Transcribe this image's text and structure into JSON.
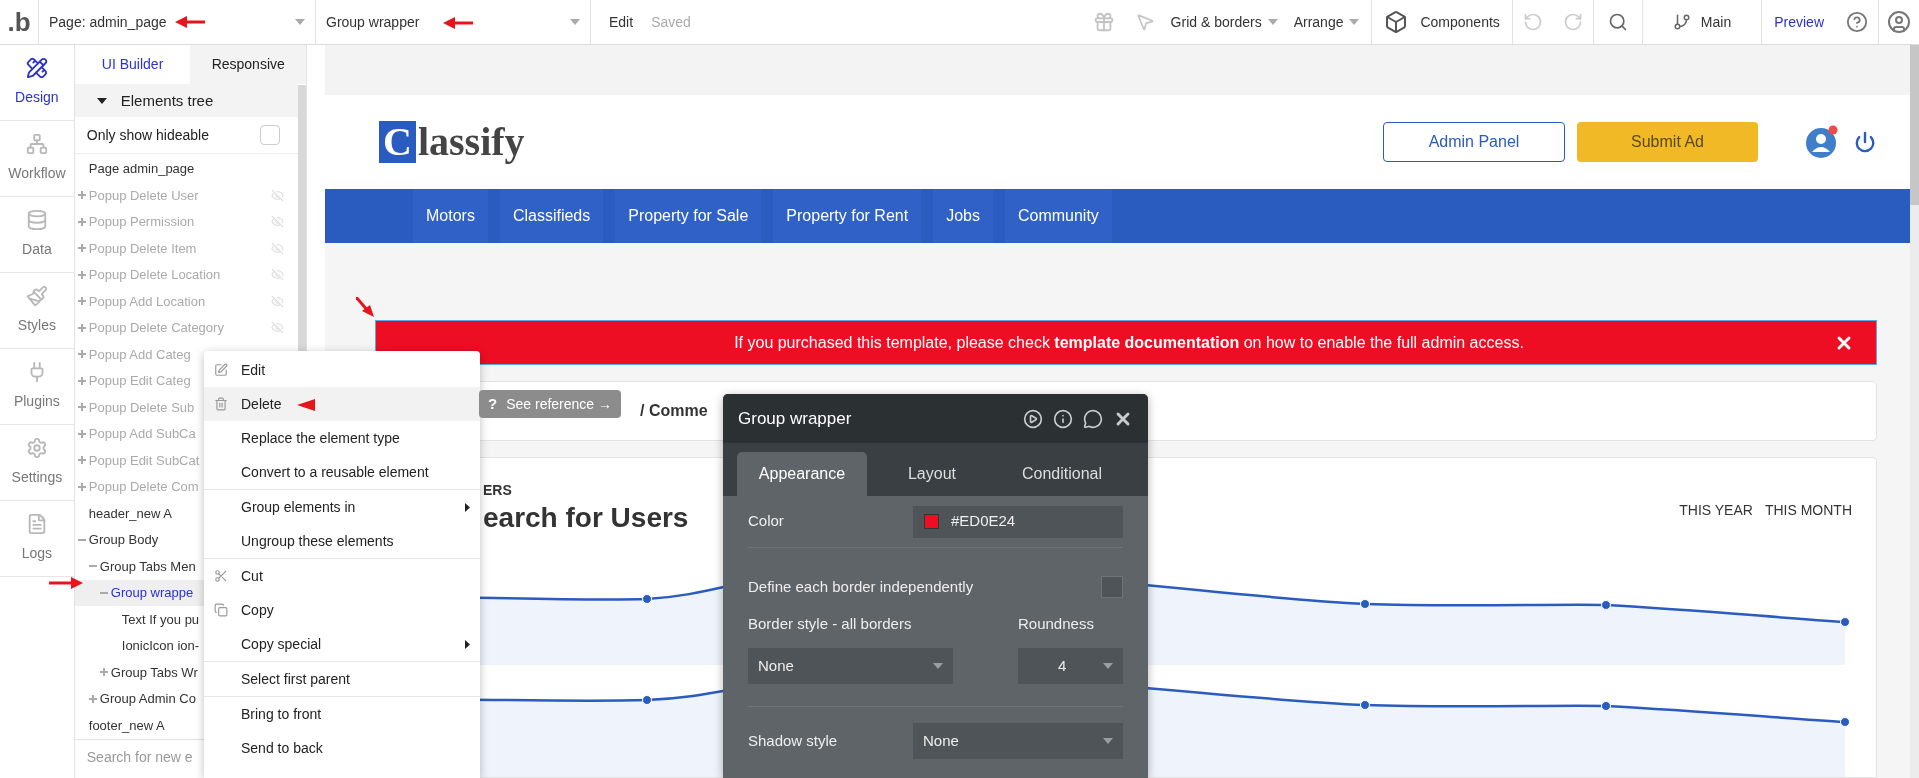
{
  "toolbar": {
    "logo": ".b",
    "page_dropdown": "Page: admin_page",
    "element_dropdown": "Group wrapper",
    "edit": "Edit",
    "status": "Saved",
    "grid": "Grid & borders",
    "arrange": "Arrange",
    "components": "Components",
    "branch": "Main",
    "preview": "Preview"
  },
  "rail": [
    {
      "label": "Design",
      "selected": true
    },
    {
      "label": "Workflow",
      "selected": false
    },
    {
      "label": "Data",
      "selected": false
    },
    {
      "label": "Styles",
      "selected": false
    },
    {
      "label": "Plugins",
      "selected": false
    },
    {
      "label": "Settings",
      "selected": false
    },
    {
      "label": "Logs",
      "selected": false
    }
  ],
  "tree_panel": {
    "tabs": [
      {
        "label": "UI Builder",
        "selected": true
      },
      {
        "label": "Responsive",
        "selected": false
      }
    ],
    "header": "Elements tree",
    "filter": {
      "label": "Only show hideable",
      "checked": false
    },
    "items": [
      {
        "label": "Page admin_page",
        "selected": false,
        "hidden": false
      },
      {
        "label": "Popup Delete User",
        "selected": false,
        "hidden": true,
        "eye_icon": true,
        "expanded": false
      },
      {
        "label": "Popup Permission",
        "selected": false,
        "hidden": true,
        "eye_icon": true,
        "expanded": false
      },
      {
        "label": "Popup Delete Item",
        "selected": false,
        "hidden": true,
        "eye_icon": true,
        "expanded": false
      },
      {
        "label": "Popup Delete Location",
        "selected": false,
        "hidden": true,
        "eye_icon": true,
        "expanded": false
      },
      {
        "label": "Popup Add Location",
        "selected": false,
        "hidden": true,
        "eye_icon": true,
        "expanded": false
      },
      {
        "label": "Popup Delete Category",
        "selected": false,
        "hidden": true,
        "eye_icon": true,
        "expanded": false
      },
      {
        "label": "Popup Add Categ",
        "selected": false,
        "hidden": true,
        "expanded": false
      },
      {
        "label": "Popup Edit Categ",
        "selected": false,
        "hidden": true,
        "expanded": false
      },
      {
        "label": "Popup Delete Sub",
        "selected": false,
        "hidden": true,
        "expanded": false
      },
      {
        "label": "Popup Add SubCa",
        "selected": false,
        "hidden": true,
        "expanded": false
      },
      {
        "label": "Popup Edit SubCat",
        "selected": false,
        "hidden": true,
        "expanded": false
      },
      {
        "label": "Popup Delete Com",
        "selected": false,
        "hidden": true,
        "expanded": false
      },
      {
        "label": "header_new A",
        "selected": false,
        "hidden": false
      },
      {
        "label": "Group Body",
        "selected": false,
        "hidden": false,
        "expanded": true,
        "children": [
          {
            "label": "Group Tabs Men",
            "selected": false,
            "hidden": false,
            "expanded": true,
            "children": [
              {
                "label": "Group wrappe",
                "selected": true,
                "hidden": false,
                "expanded": true,
                "children": [
                  {
                    "label": "Text If you pu",
                    "selected": false,
                    "hidden": false
                  },
                  {
                    "label": "IonicIcon ion-",
                    "selected": false,
                    "hidden": false
                  }
                ]
              },
              {
                "label": "Group Tabs Wr",
                "selected": false,
                "hidden": false,
                "expanded": false
              }
            ]
          },
          {
            "label": "Group Admin Co",
            "selected": false,
            "hidden": false,
            "expanded": false
          }
        ]
      },
      {
        "label": "footer_new A",
        "selected": false,
        "hidden": false
      }
    ],
    "search": {
      "placeholder": "Search for new e"
    }
  },
  "page": {
    "logo": "Classify",
    "header_buttons": [
      "Admin Panel",
      "Submit Ad"
    ],
    "nav": [
      "Motors",
      "Classifieds",
      "Property for Sale",
      "Property for Rent",
      "Jobs",
      "Community"
    ],
    "banner": "If you purchased this template, please check **template documentation** on how to enable the full admin access.",
    "breadcrumb": "/ Comme",
    "card": {
      "eyebrow": "ERS",
      "title": "earch for Users",
      "periods": [
        "THIS YEAR",
        "THIS MONTH"
      ]
    }
  },
  "context_menu": {
    "groups": [
      [
        {
          "label": "Edit",
          "selected": false,
          "submenu": false
        },
        {
          "label": "Delete",
          "selected": true,
          "submenu": false
        },
        {
          "label": "Replace the element type",
          "selected": false,
          "submenu": false
        },
        {
          "label": "Convert to a reusable element",
          "selected": false,
          "submenu": false
        }
      ],
      [
        {
          "label": "Group elements in",
          "selected": false,
          "submenu": true
        },
        {
          "label": "Ungroup these elements",
          "selected": false,
          "submenu": false
        }
      ],
      [
        {
          "label": "Cut",
          "selected": false,
          "submenu": false
        },
        {
          "label": "Copy",
          "selected": false,
          "submenu": false
        },
        {
          "label": "Copy special",
          "selected": false,
          "submenu": true
        }
      ],
      [
        {
          "label": "Select first parent",
          "selected": false,
          "submenu": false
        }
      ],
      [
        {
          "label": "Bring to front",
          "selected": false,
          "submenu": false
        },
        {
          "label": "Send to back",
          "selected": false,
          "submenu": false
        }
      ]
    ]
  },
  "tooltip": {
    "glyph": "?",
    "label": "See reference →"
  },
  "property_panel": {
    "title": "Group wrapper",
    "tabs": [
      {
        "label": "Appearance",
        "selected": true
      },
      {
        "label": "Layout",
        "selected": false
      },
      {
        "label": "Conditional",
        "selected": false
      }
    ],
    "rows": [
      {
        "kind": "color",
        "label": "Color",
        "value": "#ED0E24",
        "color": "#ed0e24"
      },
      {
        "kind": "checkbox",
        "label": "Define each border independently",
        "checked": false
      },
      {
        "kind": "dropdowns",
        "fields": [
          {
            "label": "Border style - all borders",
            "value": "None"
          },
          {
            "label": "Roundness",
            "value": "4"
          }
        ]
      },
      {
        "kind": "dropdown",
        "label": "Shadow style",
        "value": "None"
      }
    ]
  }
}
